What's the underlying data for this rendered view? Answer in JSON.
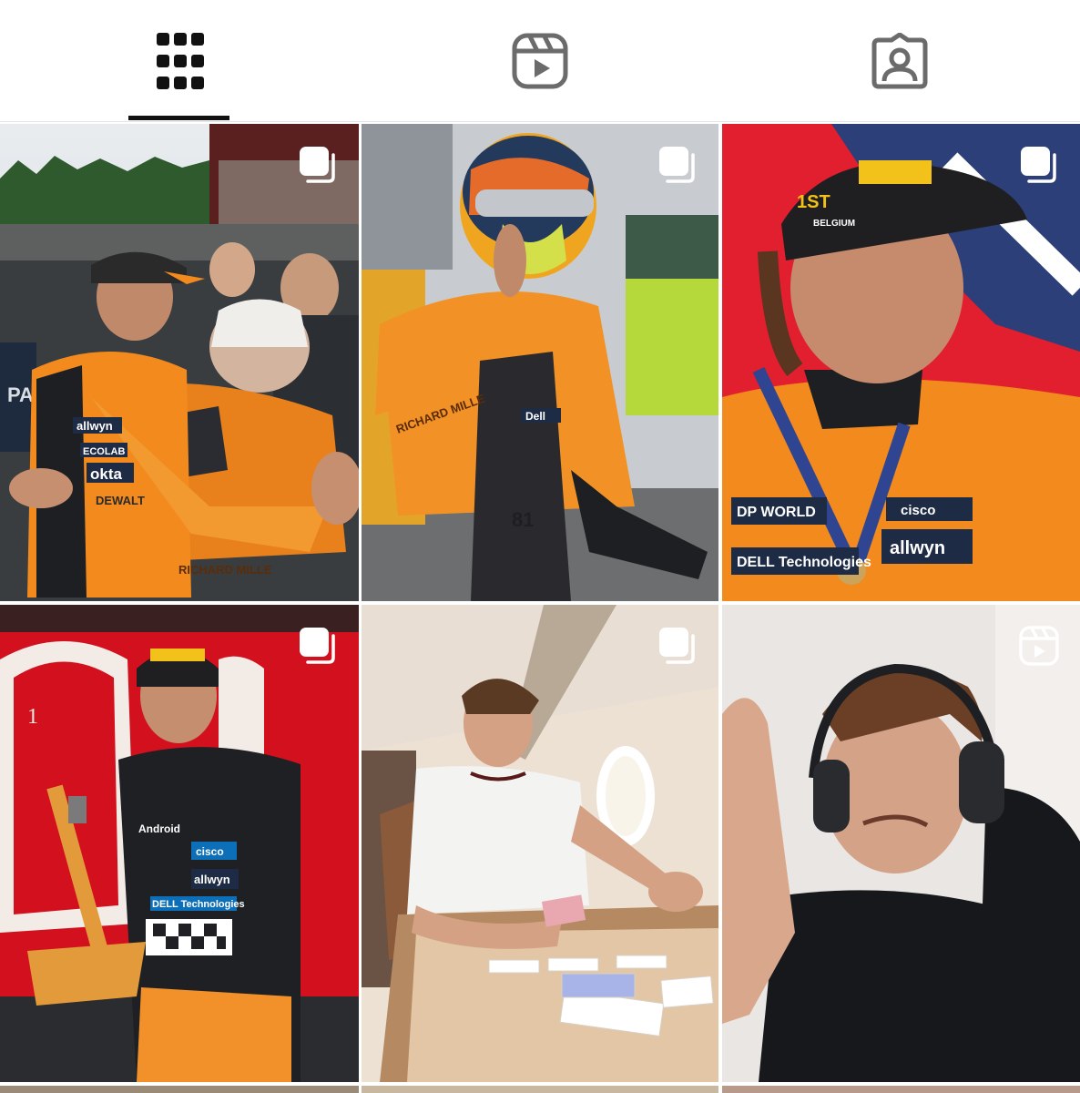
{
  "tabs": [
    {
      "name": "posts",
      "icon": "grid-icon",
      "active": true
    },
    {
      "name": "reels",
      "icon": "reels-icon",
      "active": false
    },
    {
      "name": "tagged",
      "icon": "tagged-user-icon",
      "active": false
    }
  ],
  "colors": {
    "active_icon": "#111111",
    "inactive_icon": "#6b6b6b",
    "divider": "#e6e6e6",
    "papaya": "#f28a1e",
    "badge": "#ffffff"
  },
  "posts": [
    {
      "id": "post-1",
      "type": "carousel",
      "badge_icon": "carousel-icon",
      "scene": "driver in papaya race suit hugging elderly man in crowd at circuit"
    },
    {
      "id": "post-2",
      "type": "carousel",
      "badge_icon": "carousel-icon",
      "scene": "driver in helmet pointing finger, papaya race suit with number 81"
    },
    {
      "id": "post-3",
      "type": "carousel",
      "badge_icon": "carousel-icon",
      "scene": "driver smiling wearing 1st Belgium cap with medal"
    },
    {
      "id": "post-4",
      "type": "carousel",
      "badge_icon": "carousel-icon",
      "scene": "driver in black race suit holding trophy in red room"
    },
    {
      "id": "post-5",
      "type": "carousel",
      "badge_icon": "carousel-icon",
      "scene": "driver in white t-shirt playing cards on private jet"
    },
    {
      "id": "post-6",
      "type": "reel",
      "badge_icon": "reels-icon",
      "scene": "driver with headphones in sim rig raising hand"
    }
  ],
  "photo_text": {
    "p1_banner": "PA",
    "p1_suit_sponsors": [
      "allwyn",
      "ECOLAB",
      "okta",
      "DEWALT",
      "RICHARD MILLE"
    ],
    "p2_suit_sponsors": [
      "RICHARD MILLE",
      "Dell",
      "81"
    ],
    "p3_cap": "1ST",
    "p3_cap_sub": "BELGIUM",
    "p3_sponsors": [
      "DP WORLD",
      "allwyn",
      "DELL Technologies",
      "cisco"
    ],
    "p4_sponsors": [
      "Android",
      "allwyn",
      "DELL Technologies",
      "cisco"
    ],
    "p4_number": "1"
  }
}
